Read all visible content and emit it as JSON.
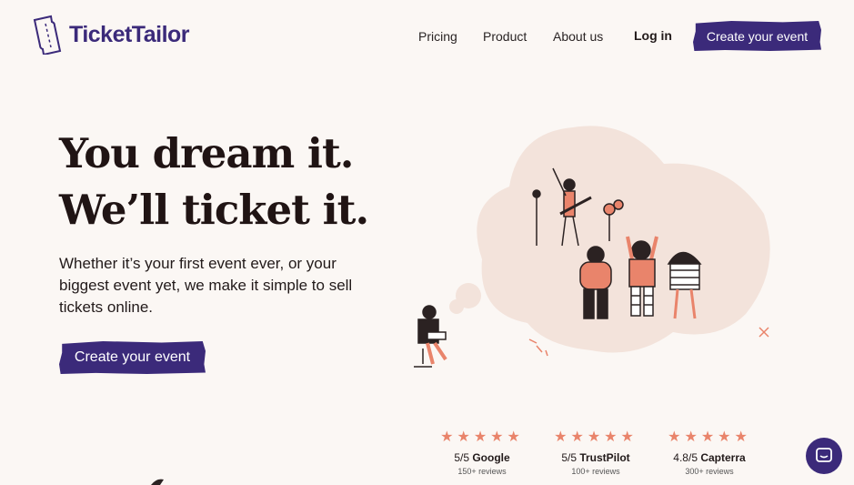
{
  "brand": {
    "logo_text": "TicketTailor"
  },
  "nav": {
    "links": [
      "Pricing",
      "Product",
      "About us"
    ],
    "login": "Log in",
    "cta": "Create your event"
  },
  "hero": {
    "title_line1": "You dream it.",
    "title_line2": "We’ll ticket it.",
    "subtitle": "Whether it’s your first event ever, or your biggest event yet, we make it simple to sell tickets online.",
    "cta": "Create your event"
  },
  "reviews": [
    {
      "stars": "★★★★★",
      "score": "5/5",
      "source": "Google",
      "count": "150+ reviews"
    },
    {
      "stars": "★★★★★",
      "score": "5/5",
      "source": "TrustPilot",
      "count": "100+ reviews"
    },
    {
      "stars": "★★★★★",
      "score": "4.8/5",
      "source": "Capterra",
      "count": "300+ reviews"
    }
  ],
  "colors": {
    "brand": "#3b2a7a",
    "accent": "#e9846b",
    "background": "#fbf7f4"
  },
  "icons": {
    "logo": "ticket-icon",
    "chat": "chat-icon"
  }
}
